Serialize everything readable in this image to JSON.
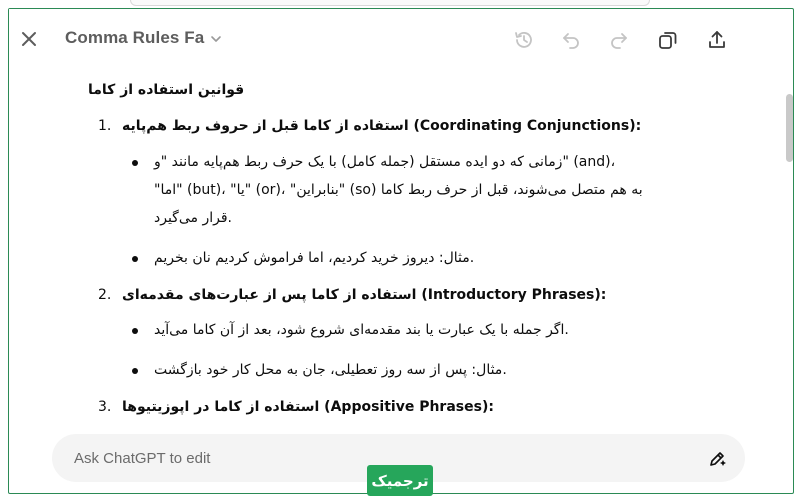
{
  "window": {
    "title": "Comma Rules Fa"
  },
  "toolbar": {
    "close": "close-icon",
    "history": "history-icon",
    "undo": "undo-icon",
    "redo": "redo-icon",
    "copy": "copy-icon",
    "share": "share-icon"
  },
  "document": {
    "heading": "قوانین استفاده از کاما",
    "sections": [
      {
        "number": "1.",
        "title": "استفاده از کاما قبل از حروف ربط هم‌پایه (Coordinating Conjunctions):",
        "bullets": [
          {
            "lines": [
              "زمانی که دو ایده مستقل (جمله کامل) با یک حرف ربط هم‌پایه مانند \"و\" (and)،",
              "\"اما\" (but)، \"یا\" (or)، \"بنابراین\" (so) به هم متصل می‌شوند، قبل از حرف ربط کاما",
              "قرار می‌گیرد."
            ]
          },
          {
            "lines": [
              "مثال: دیروز خرید کردیم، اما فراموش کردیم نان بخریم."
            ]
          }
        ]
      },
      {
        "number": "2.",
        "title": "استفاده از کاما پس از عبارت‌های مقدمه‌ای (Introductory Phrases):",
        "bullets": [
          {
            "lines": [
              "اگر جمله با یک عبارت یا بند مقدمه‌ای شروع شود، بعد از آن کاما می‌آید."
            ]
          },
          {
            "lines": [
              "مثال: پس از سه روز تعطیلی، جان به محل کار خود بازگشت."
            ]
          }
        ]
      },
      {
        "number": "3.",
        "title": "استفاده از کاما در اپوزیتیوها (Appositive Phrases):",
        "bullets": []
      }
    ]
  },
  "composer": {
    "placeholder": "Ask ChatGPT to edit",
    "edit_icon": "edit-icon"
  },
  "watermark": {
    "text": "ترجمیک"
  },
  "colors": {
    "accent_green": "#26a65b",
    "border_green": "#2b8a55",
    "icon_gray": "#5d5d5d",
    "input_bg": "#f4f4f4"
  }
}
